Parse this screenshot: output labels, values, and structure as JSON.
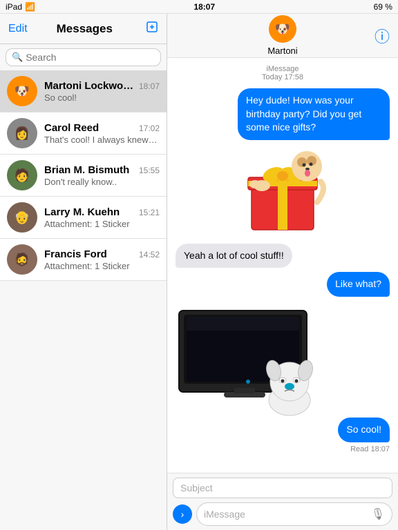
{
  "statusBar": {
    "left": "iPad",
    "time": "18:07",
    "battery": "69 %",
    "wifi": true
  },
  "leftPanel": {
    "editLabel": "Edit",
    "title": "Messages",
    "searchPlaceholder": "Search",
    "conversations": [
      {
        "id": "martoni",
        "name": "Martoni Lockwood",
        "time": "18:07",
        "preview": "So cool!",
        "avatarColor": "avatar-ml",
        "avatarEmoji": "🐶",
        "active": true
      },
      {
        "id": "carol",
        "name": "Carol Reed",
        "time": "17:02",
        "preview": "That's cool! I always knew they would make a perfect match.",
        "avatarColor": "avatar-cr",
        "avatarEmoji": "👩",
        "active": false
      },
      {
        "id": "brian",
        "name": "Brian M. Bismuth",
        "time": "15:55",
        "preview": "Don't really know..",
        "avatarColor": "avatar-bb",
        "avatarEmoji": "🧑",
        "active": false
      },
      {
        "id": "larry",
        "name": "Larry M. Kuehn",
        "time": "15:21",
        "preview": "Attachment: 1 Sticker",
        "avatarColor": "avatar-lk",
        "avatarEmoji": "👴",
        "active": false
      },
      {
        "id": "francis",
        "name": "Francis Ford",
        "time": "14:52",
        "preview": "Attachment: 1 Sticker",
        "avatarColor": "avatar-ff",
        "avatarEmoji": "🧔",
        "active": false
      }
    ]
  },
  "chatPanel": {
    "contactName": "Martoni",
    "metaLabel": "iMessage",
    "metaTime": "Today 17:58",
    "messages": [
      {
        "id": "msg1",
        "type": "sent",
        "text": "Hey dude! How was your birthday party? Did you get some nice gifts?",
        "bubble": true
      },
      {
        "id": "msg2",
        "type": "sticker-gift",
        "text": ""
      },
      {
        "id": "msg3",
        "type": "received",
        "text": "Yeah a lot of cool stuff!!",
        "bubble": true
      },
      {
        "id": "msg4",
        "type": "sent",
        "text": "Like what?",
        "bubble": true
      },
      {
        "id": "msg5",
        "type": "sticker-tv",
        "text": ""
      },
      {
        "id": "msg6",
        "type": "sent",
        "text": "So cool!",
        "bubble": true,
        "readReceipt": "Read 18:07"
      }
    ],
    "inputArea": {
      "subjectPlaceholder": "Subject",
      "messagePlaceholder": "iMessage",
      "sendLabel": "›"
    }
  }
}
